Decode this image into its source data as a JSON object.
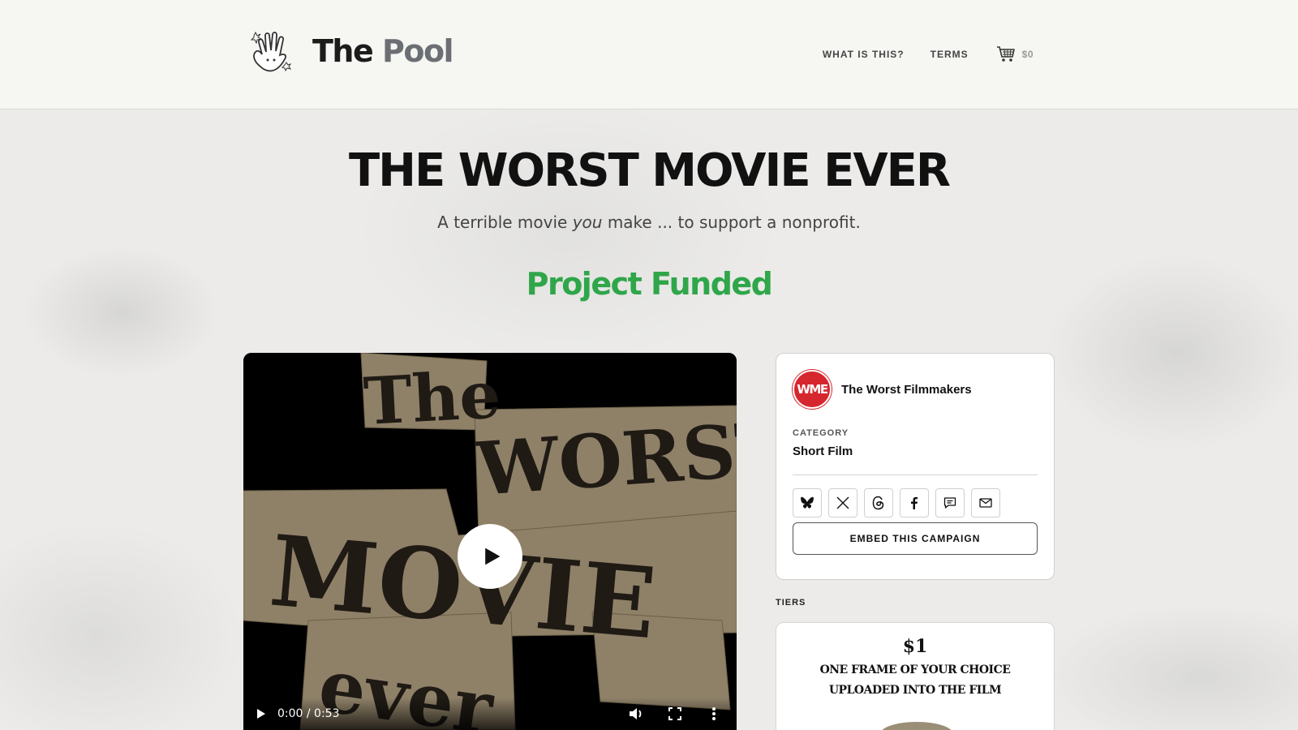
{
  "header": {
    "logo_word1": "The",
    "logo_word2": "Pool",
    "nav": {
      "what_label": "WHAT IS THIS?",
      "terms_label": "TERMS",
      "cart_amount": "$0"
    }
  },
  "hero": {
    "title": "THE WORST MOVIE EVER",
    "subtitle_before": "A terrible movie",
    "subtitle_em": "you",
    "subtitle_after": "make ... to support a nonprofit.",
    "status": "Project Funded"
  },
  "video": {
    "time": "0:00 / 0:53",
    "poster_words": [
      "THE",
      "WORST",
      "MOVIE",
      "EVER"
    ]
  },
  "card": {
    "avatar_text": "WME",
    "creator": "The Worst Filmmakers",
    "category_label": "CATEGORY",
    "category_value": "Short Film",
    "share_icons": [
      "bluesky-icon",
      "x-icon",
      "threads-icon",
      "facebook-icon",
      "sms-icon",
      "email-icon"
    ],
    "embed_label": "EMBED THIS CAMPAIGN"
  },
  "tiers": {
    "label": "TIERS",
    "items": [
      {
        "price": "$1",
        "line1": "ONE FRAME OF YOUR CHOICE",
        "line2": "UPLOADED INTO THE FILM"
      }
    ]
  },
  "colors": {
    "funded": "#2fa64a",
    "avatar_bg": "#d6262e",
    "header_bg": "#f6f6f3"
  }
}
